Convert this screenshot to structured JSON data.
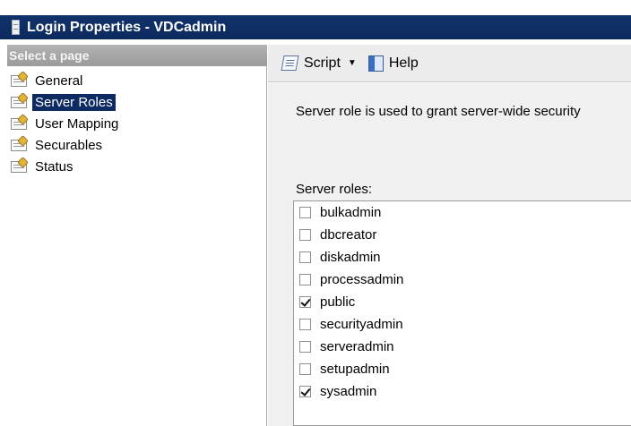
{
  "window": {
    "title": "Login Properties - VDCadmin"
  },
  "left_pane": {
    "header": "Select a page",
    "items": [
      {
        "label": "General",
        "selected": false
      },
      {
        "label": "Server Roles",
        "selected": true
      },
      {
        "label": "User Mapping",
        "selected": false
      },
      {
        "label": "Securables",
        "selected": false
      },
      {
        "label": "Status",
        "selected": false
      }
    ]
  },
  "toolbar": {
    "script_label": "Script",
    "help_label": "Help"
  },
  "main": {
    "description": "Server role is used to grant server-wide security",
    "roles_label": "Server roles:",
    "roles": [
      {
        "name": "bulkadmin",
        "checked": false
      },
      {
        "name": "dbcreator",
        "checked": false
      },
      {
        "name": "diskadmin",
        "checked": false
      },
      {
        "name": "processadmin",
        "checked": false
      },
      {
        "name": "public",
        "checked": true
      },
      {
        "name": "securityadmin",
        "checked": false
      },
      {
        "name": "serveradmin",
        "checked": false
      },
      {
        "name": "setupadmin",
        "checked": false
      },
      {
        "name": "sysadmin",
        "checked": true
      }
    ]
  },
  "colors": {
    "titlebar": "#12326b",
    "selection": "#0d2a63",
    "content_bg": "#f0f0f0"
  }
}
